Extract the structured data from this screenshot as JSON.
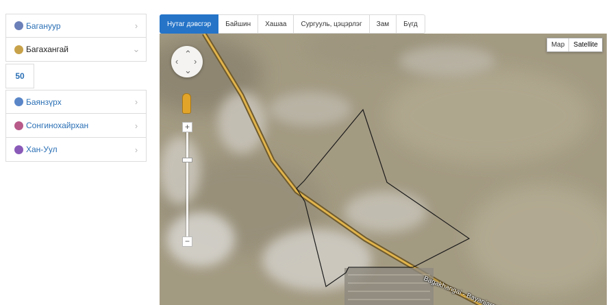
{
  "sidebar": {
    "items": [
      {
        "label": "Багануур",
        "emblem_color": "#6b7fb8",
        "chevron": "›",
        "active": false
      },
      {
        "label": "Багахангай",
        "emblem_color": "#c8a24a",
        "chevron": "⌄",
        "active": true
      },
      {
        "label": "Баянзүрх",
        "emblem_color": "#5a86c8",
        "chevron": "›",
        "active": false
      },
      {
        "label": "Сонгинохайрхан",
        "emblem_color": "#b85a8a",
        "chevron": "›",
        "active": false
      },
      {
        "label": "Хан-Уул",
        "emblem_color": "#8a5ab8",
        "chevron": "›",
        "active": false
      }
    ],
    "count": "50"
  },
  "tabs": [
    {
      "label": "Нутаг дэвсгэр",
      "active": true
    },
    {
      "label": "Байшин",
      "active": false
    },
    {
      "label": "Хашаа",
      "active": false
    },
    {
      "label": "Сургууль, цэцэрлэг",
      "active": false
    },
    {
      "label": "Зам",
      "active": false
    },
    {
      "label": "Бүгд",
      "active": false
    }
  ],
  "map": {
    "type_map": "Map",
    "type_satellite": "Satellite",
    "selected_type": "Satellite",
    "road_label": "Bagakhangai - Bayanjargalan R",
    "zoom_in": "+",
    "zoom_out": "−"
  }
}
